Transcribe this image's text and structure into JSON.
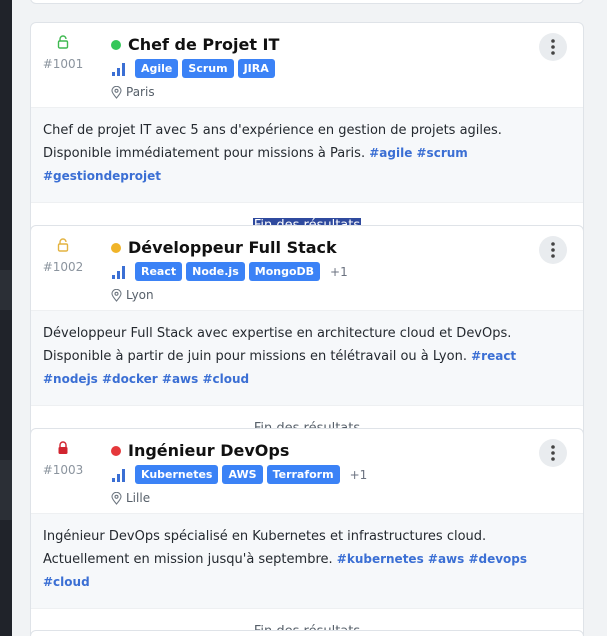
{
  "cards": [
    {
      "id": "#1001",
      "title": "Chef de Projet IT",
      "status_color": "#34c759",
      "lock_color": "#3fb950",
      "tags": [
        "Agile",
        "Scrum",
        "JIRA"
      ],
      "more": "",
      "location": "Paris",
      "description": "Chef de projet IT avec 5 ans d'expérience en gestion de projets agiles. Disponible immédiatement pour missions à Paris.",
      "hashtags": "#agile #scrum #gestiondeprojet",
      "footer": "Fin des résultats",
      "footer_selected": true
    },
    {
      "id": "#1002",
      "title": "Développeur Full Stack",
      "status_color": "#f0b429",
      "lock_color": "#e3b341",
      "tags": [
        "React",
        "Node.js",
        "MongoDB"
      ],
      "more": "+1",
      "location": "Lyon",
      "description": "Développeur Full Stack avec expertise en architecture cloud et DevOps. Disponible à partir de juin pour missions en télétravail ou à Lyon.",
      "hashtags": "#react #nodejs #docker #aws #cloud",
      "footer": "Fin des résultats",
      "footer_selected": false
    },
    {
      "id": "#1003",
      "title": "Ingénieur DevOps",
      "status_color": "#e5383b",
      "lock_color": "#d1242f",
      "tags": [
        "Kubernetes",
        "AWS",
        "Terraform"
      ],
      "more": "+1",
      "location": "Lille",
      "description": "Ingénieur DevOps spécialisé en Kubernetes et infrastructures cloud. Actuellement en mission jusqu'à septembre.",
      "hashtags": "#kubernetes #aws #devops #cloud",
      "footer": "Fin des résultats",
      "footer_selected": false
    }
  ],
  "colors": {
    "tag_bg": "#3b82f6",
    "hashtag": "#3b6fd4",
    "signal": "#3b6fd4"
  }
}
